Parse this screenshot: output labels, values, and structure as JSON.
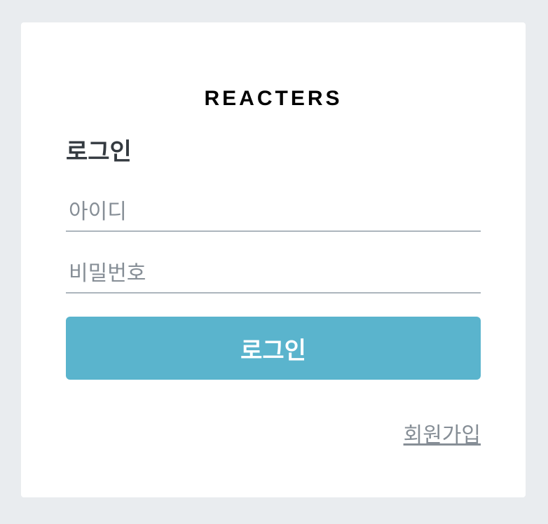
{
  "brand": {
    "title": "REACTERS"
  },
  "login_form": {
    "heading": "로그인",
    "username_placeholder": "아이디",
    "username_value": "",
    "password_placeholder": "비밀번호",
    "password_value": "",
    "submit_label": "로그인",
    "signup_link": "회원가입"
  },
  "colors": {
    "page_background": "#e9ecef",
    "card_background": "#ffffff",
    "button_accent": "#5ab4cd",
    "field_underline": "#adb5bd",
    "muted_text": "#868e96"
  }
}
